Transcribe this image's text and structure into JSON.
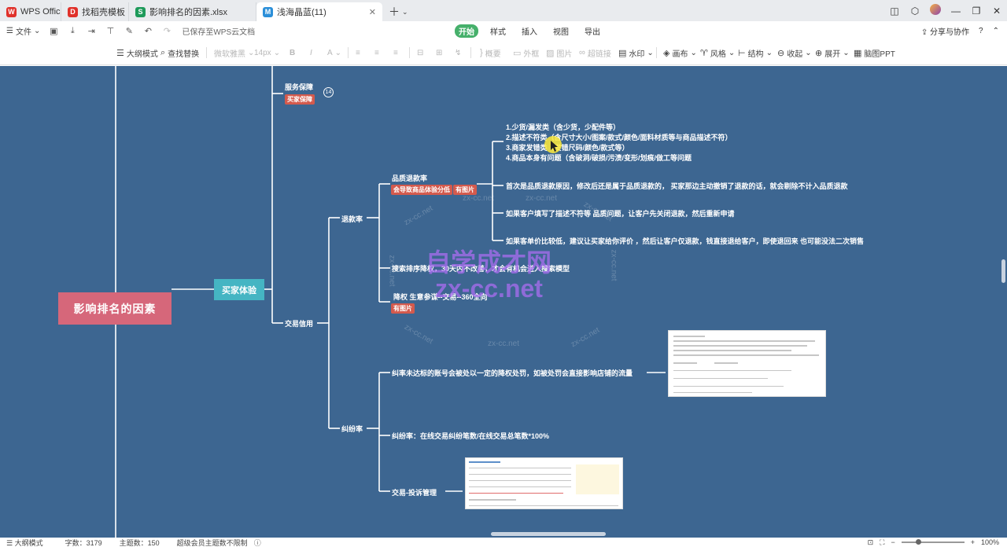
{
  "tabs": [
    {
      "label": "WPS Office",
      "color": "#e0312a",
      "glyph": "W"
    },
    {
      "label": "找稻壳模板",
      "color": "#e0312a",
      "glyph": "D"
    },
    {
      "label": "影响排名的因素.xlsx",
      "color": "#1e9a5a",
      "glyph": "S"
    },
    {
      "label": "浅海晶蓝(11)",
      "color": "#2b8fd9",
      "glyph": "M",
      "active": true
    }
  ],
  "menubar": {
    "file_label": "文件",
    "saved_text": "已保存至WPS云文档",
    "center": [
      "开始",
      "样式",
      "插入",
      "视图",
      "导出"
    ],
    "active_menu": "开始",
    "share_label": "分享与协作"
  },
  "toolbar": {
    "outline_mode": "大纲模式",
    "find_replace": "查找替换",
    "font_family": "微软雅黑",
    "font_size": "14px",
    "bold": "B",
    "italic": "I",
    "font_color": "A",
    "summary": "概要",
    "outer_box": "外框",
    "image": "图片",
    "hyperlink": "超链接",
    "watermark": "水印",
    "canvas": "画布",
    "style": "风格",
    "structure": "结构",
    "collapse": "收起",
    "expand": "展开",
    "brain_ppt": "脑图PPT"
  },
  "mindmap": {
    "root": "影响排名的因素",
    "level1": "买家体验",
    "service_guarantee": "服务保障",
    "service_tag": "买家保障",
    "service_badge": "14",
    "trade_credit": "交易信用",
    "refund_rate": "退款率",
    "dispute_rate": "纠纷率",
    "quality_refund": "品质退款率",
    "quality_tag1": "会导致商品体验分低",
    "quality_tag2": "有图片",
    "quality_items": [
      "1.少货/漏发类（含少货，少配件等）",
      "2.描述不符类（含尺寸大小/图案/款式/颜色/面料材质等与商品描述不符）",
      "3.商家发错类（发错尺码/颜色/款式等）",
      "4.商品本身有问题（含破洞/破损/污渍/变形/划痕/做工等问题"
    ],
    "refund_notes": [
      "首次是品质退款原因，修改后还是属于品质退款的， 买家那边主动撤销了退款的话，就会剔除不计入品质退款",
      "如果客户填写了描述不符等 品质问题，让客户先关闭退款，然后重新申请",
      "如果客单价比较低，建议让买家给你评价 ，然后让客户仅退款，钱直接退给客户，即使退回来 也可能没法二次销售"
    ],
    "search_drop": "搜索排序降权，30天内不改善，才会有机会进入搜索模型",
    "demotion": "降权 生意参谋--交易--360全向",
    "demotion_tag": "有图片",
    "dispute_note": "纠率未达标的账号会被处以一定的降权处罚，如被处罚会直接影响店铺的流量",
    "dispute_formula": "纠纷率：在线交易纠纷笔数/在线交易总笔数*100%",
    "complaint_mgmt": "交易-投诉管理"
  },
  "watermarks": {
    "small": "zx-cc.net",
    "big_cn": "自学成才网",
    "big_en": "zx-cc.net"
  },
  "statusbar": {
    "outline_mode": "大纲模式",
    "word_count": "字数：3179",
    "topic_count": "主题数：150",
    "vip_note": "超级会员主题数不限制",
    "zoom": "100%"
  },
  "colors": {
    "canvas_bg": "#3d6691",
    "root_bg": "#d6677a",
    "level1_bg": "#45b5c3",
    "tag_bg": "#d45a4d",
    "accent_green": "#46b06b"
  }
}
